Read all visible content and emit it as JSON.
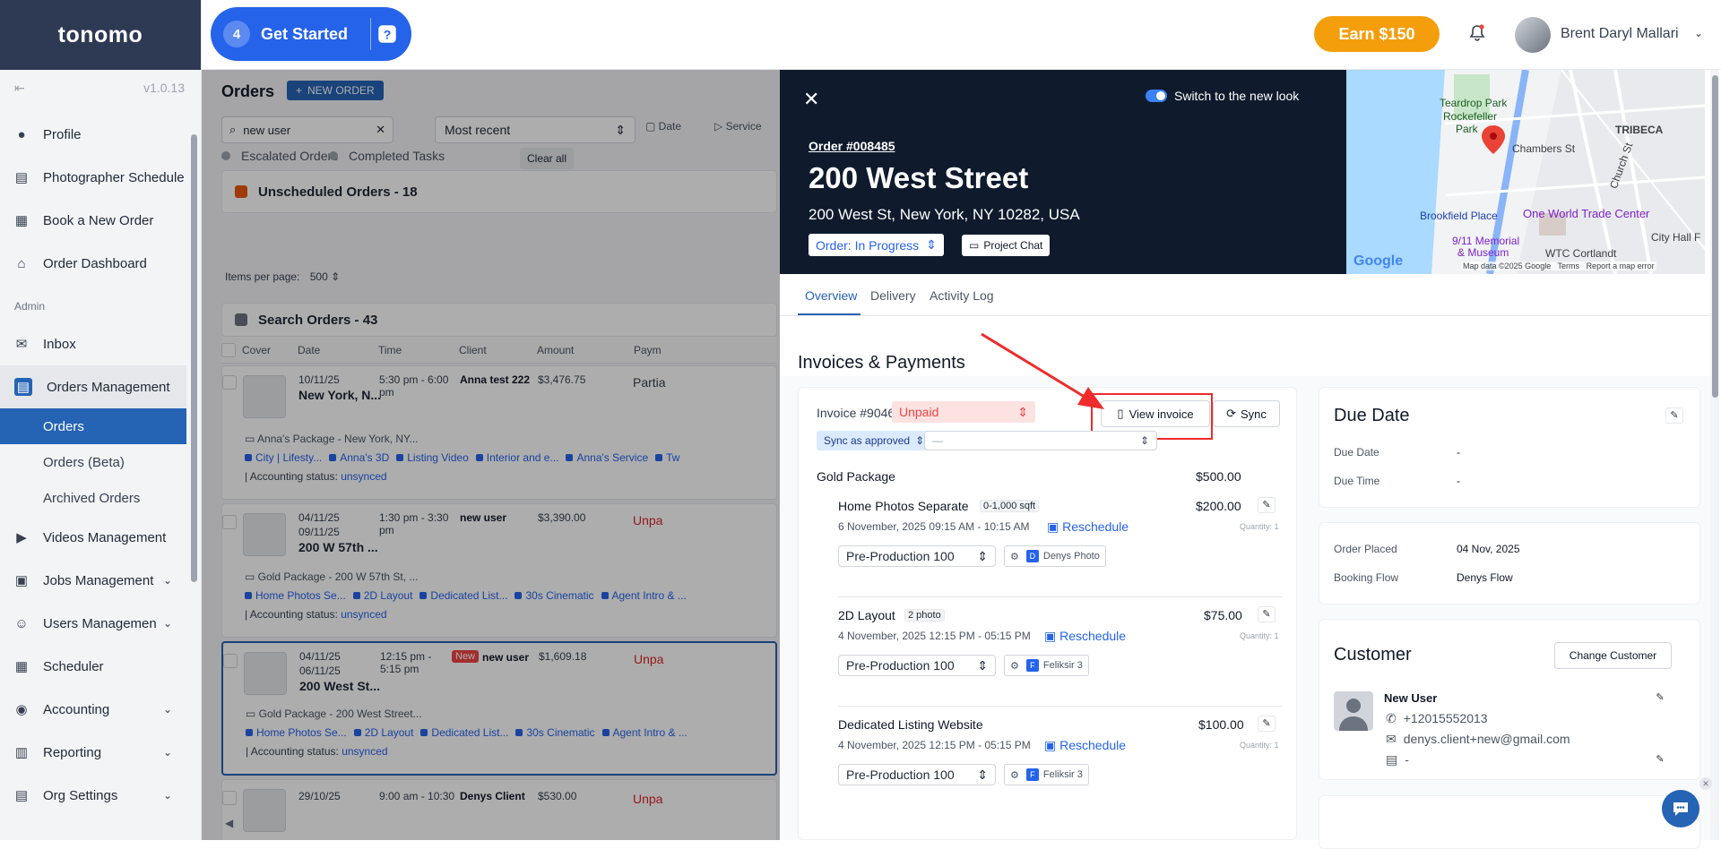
{
  "app": {
    "logo": "tonomo",
    "version": "v1.0.13"
  },
  "topbar": {
    "get_started_count": "4",
    "get_started_label": "Get Started",
    "earn_label": "Earn $150",
    "user_name": "Brent Daryl Mallari"
  },
  "sidebar": {
    "items_top": [
      {
        "label": "Profile",
        "icon": "person-icon"
      },
      {
        "label": "Photographer Schedule",
        "icon": "clipboard-icon"
      },
      {
        "label": "Book a New Order",
        "icon": "book-icon"
      },
      {
        "label": "Order Dashboard",
        "icon": "home-icon"
      }
    ],
    "admin_label": "Admin",
    "inbox": "Inbox",
    "orders_management": "Orders Management",
    "sub_items": [
      "Orders",
      "Orders (Beta)",
      "Archived Orders"
    ],
    "items_bottom": [
      {
        "label": "Videos Management",
        "chevron": false
      },
      {
        "label": "Jobs Management",
        "chevron": true
      },
      {
        "label": "Users Managemen",
        "chevron": true
      },
      {
        "label": "Scheduler",
        "chevron": false
      },
      {
        "label": "Accounting",
        "chevron": true
      },
      {
        "label": "Reporting",
        "chevron": true
      },
      {
        "label": "Org Settings",
        "chevron": true
      }
    ]
  },
  "orders": {
    "title": "Orders",
    "new_order": "NEW ORDER",
    "search_value": "new user",
    "sort_value": "Most recent",
    "filter_date": "Date",
    "filter_service": "Service",
    "filter_escalated": "Escalated Orders",
    "filter_completed": "Completed Tasks",
    "clear_all": "Clear all",
    "unscheduled": "Unscheduled Orders - 18",
    "items_per_page_label": "Items per page:",
    "items_per_page_value": "500",
    "search_orders": "Search Orders - 43",
    "columns": [
      "Cover",
      "Date",
      "Time",
      "Client",
      "Amount",
      "Paym"
    ],
    "rows": [
      {
        "date": "10/11/25",
        "date2": "",
        "title": "New York, N...",
        "time": "5:30 pm - 6:00 pm",
        "new_badge": "",
        "client": "Anna test 222",
        "amount": "$3,476.75",
        "payment": "Partia",
        "package": "Anna's Package - New York, NY...",
        "chips": [
          "City | Lifesty...",
          "Anna's 3D",
          "Listing Video",
          "Interior and e...",
          "Anna's Service",
          "Tw"
        ],
        "acct_label": "Accounting status:",
        "acct_value": "unsynced"
      },
      {
        "date": "04/11/25",
        "date2": "09/11/25",
        "title": "200 W 57th ...",
        "time": "1:30 pm - 3:30 pm",
        "new_badge": "",
        "client": "new user",
        "amount": "$3,390.00",
        "payment": "Unpa",
        "package": "Gold Package - 200 W 57th St, ...",
        "chips": [
          "Home Photos Se...",
          "2D Layout",
          "Dedicated List...",
          "30s Cinematic",
          "Agent Intro & ..."
        ],
        "acct_label": "Accounting status:",
        "acct_value": "unsynced"
      },
      {
        "date": "04/11/25",
        "date2": "06/11/25",
        "title": "200 West St...",
        "time": "12:15 pm - 5:15 pm",
        "new_badge": "New",
        "client": "new user",
        "amount": "$1,609.18",
        "payment": "Unpa",
        "package": "Gold Package - 200 West Street...",
        "chips": [
          "Home Photos Se...",
          "2D Layout",
          "Dedicated List...",
          "30s Cinematic",
          "Agent Intro & ..."
        ],
        "acct_label": "Accounting status:",
        "acct_value": "unsynced"
      },
      {
        "date": "29/10/25",
        "date2": "",
        "title": "",
        "time": "9:00 am - 10:30",
        "new_badge": "",
        "client": "Denys Client",
        "amount": "$530.00",
        "payment": "Unpa",
        "package": "",
        "chips": [],
        "acct_label": "",
        "acct_value": ""
      }
    ]
  },
  "panel": {
    "switch_label": "Switch to the new look",
    "order_number": "Order #008485",
    "title": "200 West Street",
    "address": "200 West St, New York, NY 10282, USA",
    "status": "Order: In Progress",
    "project_chat": "Project Chat",
    "map_labels": [
      "Teardrop Park",
      "Rockefeller",
      "Park",
      "TRIBECA",
      "Chambers St",
      "Church St",
      "Brookfield Place",
      "One World Trade Center",
      "City Hall F",
      "9/11 Memorial",
      "& Museum",
      "WTC Cortlandt"
    ],
    "map_footer": [
      "Map data ©2025 Google",
      "Terms",
      "Report a map error"
    ],
    "map_brand": "Google",
    "tabs": [
      "Overview",
      "Delivery",
      "Activity Log"
    ],
    "section_title": "Invoices & Payments",
    "invoice_label": "Invoice #9046",
    "invoice_status": "Unpaid",
    "view_invoice": "View invoice",
    "sync": "Sync",
    "sync_as_approved": "Sync as approved",
    "dash_value": "—",
    "package_name": "Gold Package",
    "package_price": "$500.00",
    "line_items": [
      {
        "name": "Home Photos Separate",
        "tag": "0-1,000 sqft",
        "price": "$200.00",
        "datetime": "6 November, 2025 09:15 AM - 10:15 AM",
        "reschedule": "Reschedule",
        "quantity": "Quantity: 1",
        "stage": "Pre-Production 100",
        "assignee_initial": "D",
        "assignee": "Denys Photo"
      },
      {
        "name": "2D Layout",
        "tag": "2 photo",
        "price": "$75.00",
        "datetime": "4 November, 2025 12:15 PM - 05:15 PM",
        "reschedule": "Reschedule",
        "quantity": "Quantity: 1",
        "stage": "Pre-Production 100",
        "assignee_initial": "F",
        "assignee": "Feliksir 3"
      },
      {
        "name": "Dedicated Listing Website",
        "tag": "",
        "price": "$100.00",
        "datetime": "4 November, 2025 12:15 PM - 05:15 PM",
        "reschedule": "Reschedule",
        "quantity": "Quantity: 1",
        "stage": "Pre-Production 100",
        "assignee_initial": "F",
        "assignee": "Feliksir 3"
      }
    ],
    "due": {
      "title": "Due Date",
      "date_label": "Due Date",
      "date_value": "-",
      "time_label": "Due Time",
      "time_value": "-"
    },
    "placed": {
      "placed_label": "Order Placed",
      "placed_value": "04 Nov, 2025",
      "flow_label": "Booking Flow",
      "flow_value": "Denys Flow"
    },
    "customer": {
      "title": "Customer",
      "change": "Change Customer",
      "name": "New User",
      "phone": "+12015552013",
      "email": "denys.client+new@gmail.com",
      "other": "-"
    }
  },
  "annotation": {
    "color": "#ef2b2b"
  }
}
